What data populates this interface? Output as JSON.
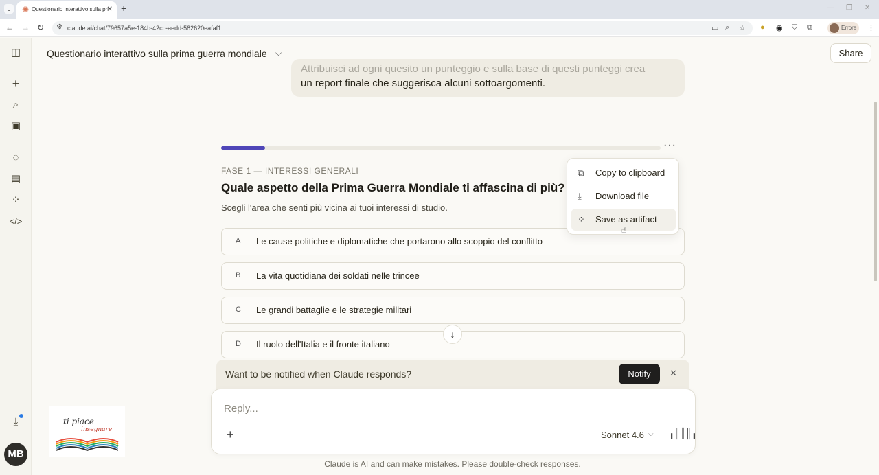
{
  "browser": {
    "tab_title": "Questionario interattivo sulla pri",
    "url": "claude.ai/chat/79657a5e-184b-42cc-aedd-582620eafaf1",
    "profile_label": "Errore"
  },
  "header": {
    "title": "Questionario interattivo sulla prima guerra mondiale",
    "share_label": "Share"
  },
  "user_message": {
    "line1": "Attribuisci ad ogni quesito un punteggio e sulla base di questi punteggi crea",
    "line2": "un report finale che suggerisca alcuni sottoargomenti."
  },
  "quiz": {
    "progress": 0.1,
    "phase": "FASE 1 — INTERESSI GENERALI",
    "question": "Quale aspetto della Prima Guerra Mondiale ti affascina di più?",
    "subtitle": "Scegli l'area che senti più vicina ai tuoi interessi di studio.",
    "options": [
      {
        "key": "A",
        "text": "Le cause politiche e diplomatiche che portarono allo scoppio del conflitto"
      },
      {
        "key": "B",
        "text": "La vita quotidiana dei soldati nelle trincee"
      },
      {
        "key": "C",
        "text": "Le grandi battaglie e le strategie militari"
      },
      {
        "key": "D",
        "text": "Il ruolo dell'Italia e il fronte italiano"
      }
    ]
  },
  "menu": {
    "items": [
      {
        "label": "Copy to clipboard",
        "icon": "copy-icon"
      },
      {
        "label": "Download file",
        "icon": "download-icon"
      },
      {
        "label": "Save as artifact",
        "icon": "artifact-icon"
      }
    ]
  },
  "notify": {
    "message": "Want to be notified when Claude responds?",
    "button_label": "Notify"
  },
  "composer": {
    "placeholder": "Reply...",
    "model": "Sonnet 4.6"
  },
  "disclaimer": "Claude is AI and can make mistakes. Please double-check responses.",
  "user": {
    "initials": "MB"
  },
  "logo": {
    "text_line1": "ti piace",
    "text_line2": "insegnare"
  },
  "colors": {
    "accent": "#4f46b8",
    "brand": "#d97757",
    "notify_button": "#1f1e1d"
  }
}
